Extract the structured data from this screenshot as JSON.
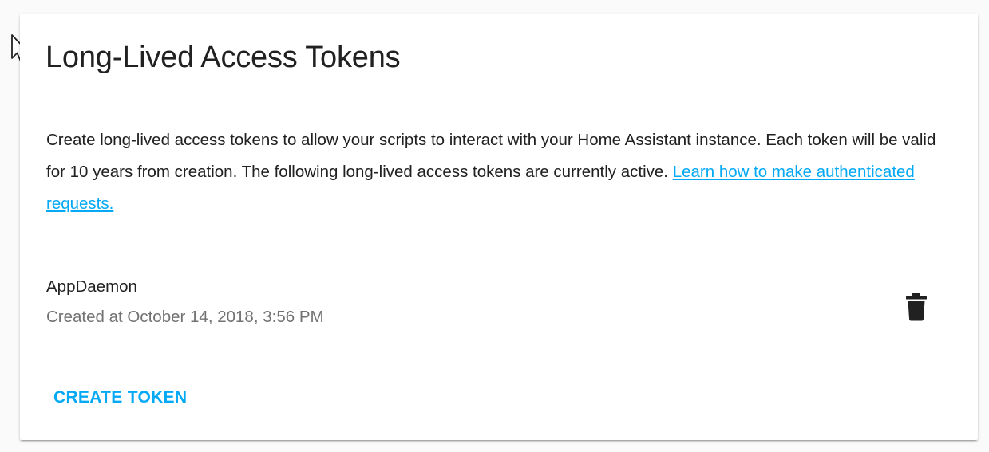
{
  "card": {
    "title": "Long-Lived Access Tokens",
    "description_text": "Create long-lived access tokens to allow your scripts to interact with your Home Assistant instance. Each token will be valid for 10 years from creation. The following long-lived access tokens are currently active. ",
    "learn_link": "Learn how to make authenticated requests."
  },
  "tokens": [
    {
      "name": "AppDaemon",
      "created": "Created at October 14, 2018, 3:56 PM",
      "delete_icon": "trash-can-icon"
    }
  ],
  "actions": {
    "create_label": "CREATE TOKEN"
  },
  "colors": {
    "accent": "#03a9f4",
    "primary_text": "#212121",
    "secondary_text": "#727272",
    "background": "#fafafa",
    "card": "#ffffff"
  }
}
